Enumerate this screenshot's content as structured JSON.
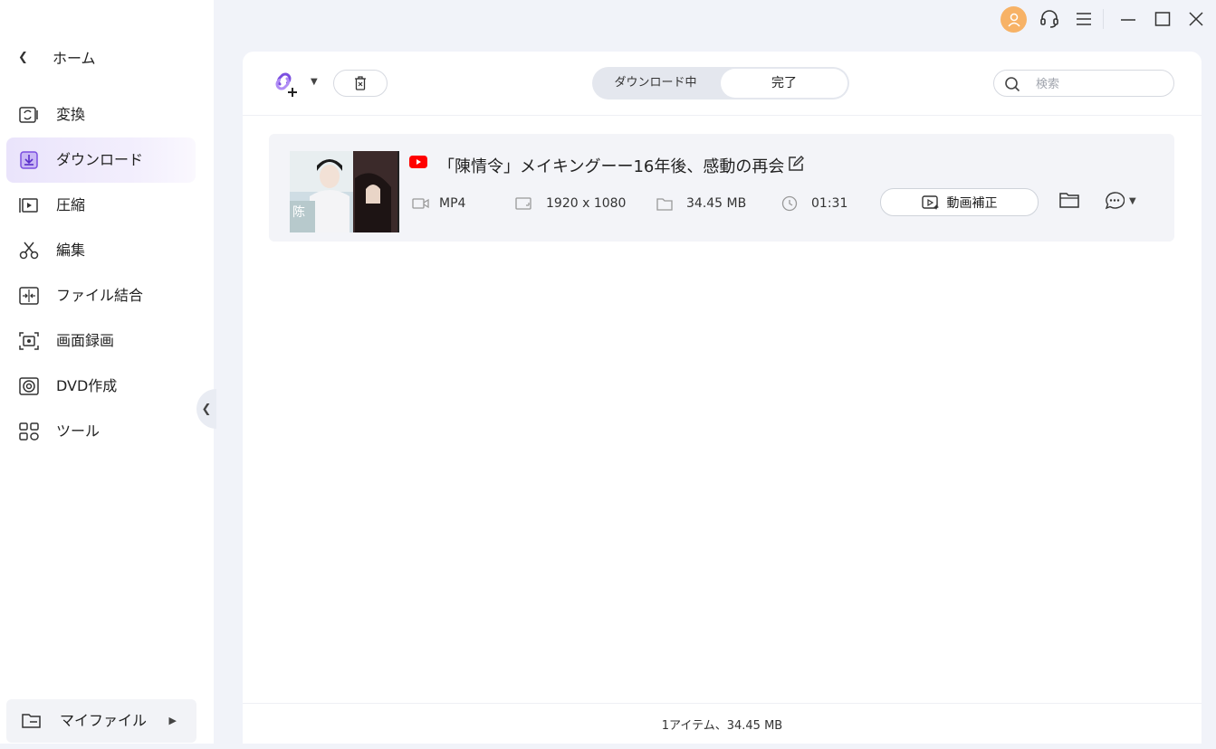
{
  "sidebar": {
    "home_label": "ホーム",
    "items": [
      {
        "label": "変換",
        "icon": "convert-icon"
      },
      {
        "label": "ダウンロード",
        "icon": "download-icon"
      },
      {
        "label": "圧縮",
        "icon": "compress-icon"
      },
      {
        "label": "編集",
        "icon": "scissors-icon"
      },
      {
        "label": "ファイル結合",
        "icon": "merge-icon"
      },
      {
        "label": "画面録画",
        "icon": "screen-record-icon"
      },
      {
        "label": "DVD作成",
        "icon": "dvd-icon"
      },
      {
        "label": "ツール",
        "icon": "tools-icon"
      }
    ],
    "active_item": "ダウンロード",
    "myfiles_label": "マイファイル"
  },
  "toolbar": {
    "tabs": [
      "ダウンロード中",
      "完了"
    ],
    "active_tab": "完了",
    "search_placeholder": "検索"
  },
  "download_item": {
    "title": "「陳情令」メイキングーー16年後、感動の再会",
    "format": "MP4",
    "resolution": "1920 x 1080",
    "size": "34.45 MB",
    "duration": "01:31",
    "enhance_label": "動画補正"
  },
  "footer": {
    "summary": "1アイテム、34.45 MB"
  },
  "colors": {
    "accent": "#7b4fe0",
    "avatar": "#f7b266",
    "youtube": "#ff0000",
    "active_nav_bg": "#eae4fb"
  }
}
